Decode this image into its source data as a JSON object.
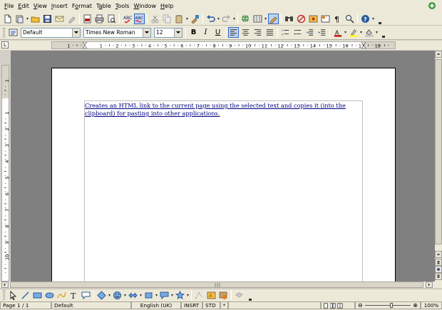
{
  "menu": {
    "items": [
      {
        "label": "File",
        "key": "F",
        "rest": "ile"
      },
      {
        "label": "Edit",
        "key": "E",
        "rest": "dit"
      },
      {
        "label": "View",
        "key": "V",
        "rest": "iew"
      },
      {
        "label": "Insert",
        "key": "I",
        "rest": "nsert"
      },
      {
        "label": "Format",
        "key": "o",
        "pre": "F",
        "rest": "rmat"
      },
      {
        "label": "Table",
        "key": "a",
        "pre": "T",
        "rest": "ble"
      },
      {
        "label": "Tools",
        "key": "T",
        "rest": "ools"
      },
      {
        "label": "Window",
        "key": "W",
        "rest": "indow"
      },
      {
        "label": "Help",
        "key": "H",
        "rest": "elp"
      }
    ]
  },
  "formatting": {
    "style_value": "Default",
    "font_value": "Times New Roman",
    "size_value": "12",
    "bold_label": "B",
    "italic_label": "I",
    "underline_label": "U"
  },
  "ruler": {
    "h_labels": [
      "1",
      "1",
      "2",
      "3",
      "4",
      "5",
      "6",
      "7",
      "8",
      "9",
      "10",
      "11",
      "12",
      "13",
      "14",
      "15",
      "16",
      "17",
      "18"
    ],
    "v_labels": [
      "1",
      "1",
      "2",
      "3",
      "4",
      "5",
      "6",
      "7",
      "8",
      "9",
      "10"
    ]
  },
  "document": {
    "text": "Creates an HTML link to the current page using the selected text and copies it (into the clipboard) for pasting into other applications."
  },
  "status": {
    "page": "Page 1 / 1",
    "style": "Default",
    "language": "English (UK)",
    "insert_mode": "INSRT",
    "selection_mode": "STD",
    "modified": "*",
    "zoom": "100%"
  },
  "colors": {
    "link": "#00007f",
    "chrome": "#ece9d8",
    "workspace": "#808080",
    "active_button": "#c1d2ee"
  }
}
